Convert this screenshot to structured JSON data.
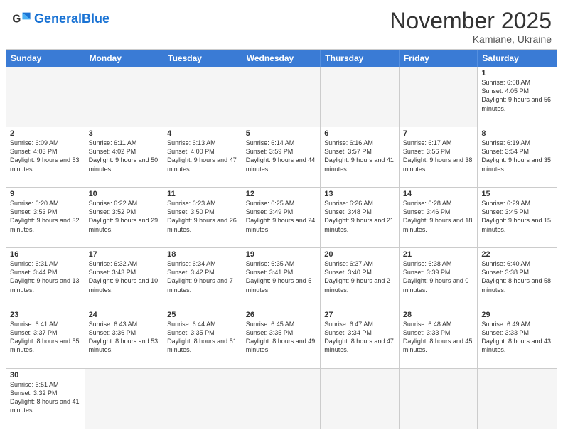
{
  "header": {
    "logo_general": "General",
    "logo_blue": "Blue",
    "month_title": "November 2025",
    "subtitle": "Kamiane, Ukraine"
  },
  "weekdays": [
    "Sunday",
    "Monday",
    "Tuesday",
    "Wednesday",
    "Thursday",
    "Friday",
    "Saturday"
  ],
  "rows": [
    [
      {
        "num": "",
        "info": "",
        "empty": true
      },
      {
        "num": "",
        "info": "",
        "empty": true
      },
      {
        "num": "",
        "info": "",
        "empty": true
      },
      {
        "num": "",
        "info": "",
        "empty": true
      },
      {
        "num": "",
        "info": "",
        "empty": true
      },
      {
        "num": "",
        "info": "",
        "empty": true
      },
      {
        "num": "1",
        "info": "Sunrise: 6:08 AM\nSunset: 4:05 PM\nDaylight: 9 hours and 56 minutes.",
        "empty": false
      }
    ],
    [
      {
        "num": "2",
        "info": "Sunrise: 6:09 AM\nSunset: 4:03 PM\nDaylight: 9 hours and 53 minutes.",
        "empty": false
      },
      {
        "num": "3",
        "info": "Sunrise: 6:11 AM\nSunset: 4:02 PM\nDaylight: 9 hours and 50 minutes.",
        "empty": false
      },
      {
        "num": "4",
        "info": "Sunrise: 6:13 AM\nSunset: 4:00 PM\nDaylight: 9 hours and 47 minutes.",
        "empty": false
      },
      {
        "num": "5",
        "info": "Sunrise: 6:14 AM\nSunset: 3:59 PM\nDaylight: 9 hours and 44 minutes.",
        "empty": false
      },
      {
        "num": "6",
        "info": "Sunrise: 6:16 AM\nSunset: 3:57 PM\nDaylight: 9 hours and 41 minutes.",
        "empty": false
      },
      {
        "num": "7",
        "info": "Sunrise: 6:17 AM\nSunset: 3:56 PM\nDaylight: 9 hours and 38 minutes.",
        "empty": false
      },
      {
        "num": "8",
        "info": "Sunrise: 6:19 AM\nSunset: 3:54 PM\nDaylight: 9 hours and 35 minutes.",
        "empty": false
      }
    ],
    [
      {
        "num": "9",
        "info": "Sunrise: 6:20 AM\nSunset: 3:53 PM\nDaylight: 9 hours and 32 minutes.",
        "empty": false
      },
      {
        "num": "10",
        "info": "Sunrise: 6:22 AM\nSunset: 3:52 PM\nDaylight: 9 hours and 29 minutes.",
        "empty": false
      },
      {
        "num": "11",
        "info": "Sunrise: 6:23 AM\nSunset: 3:50 PM\nDaylight: 9 hours and 26 minutes.",
        "empty": false
      },
      {
        "num": "12",
        "info": "Sunrise: 6:25 AM\nSunset: 3:49 PM\nDaylight: 9 hours and 24 minutes.",
        "empty": false
      },
      {
        "num": "13",
        "info": "Sunrise: 6:26 AM\nSunset: 3:48 PM\nDaylight: 9 hours and 21 minutes.",
        "empty": false
      },
      {
        "num": "14",
        "info": "Sunrise: 6:28 AM\nSunset: 3:46 PM\nDaylight: 9 hours and 18 minutes.",
        "empty": false
      },
      {
        "num": "15",
        "info": "Sunrise: 6:29 AM\nSunset: 3:45 PM\nDaylight: 9 hours and 15 minutes.",
        "empty": false
      }
    ],
    [
      {
        "num": "16",
        "info": "Sunrise: 6:31 AM\nSunset: 3:44 PM\nDaylight: 9 hours and 13 minutes.",
        "empty": false
      },
      {
        "num": "17",
        "info": "Sunrise: 6:32 AM\nSunset: 3:43 PM\nDaylight: 9 hours and 10 minutes.",
        "empty": false
      },
      {
        "num": "18",
        "info": "Sunrise: 6:34 AM\nSunset: 3:42 PM\nDaylight: 9 hours and 7 minutes.",
        "empty": false
      },
      {
        "num": "19",
        "info": "Sunrise: 6:35 AM\nSunset: 3:41 PM\nDaylight: 9 hours and 5 minutes.",
        "empty": false
      },
      {
        "num": "20",
        "info": "Sunrise: 6:37 AM\nSunset: 3:40 PM\nDaylight: 9 hours and 2 minutes.",
        "empty": false
      },
      {
        "num": "21",
        "info": "Sunrise: 6:38 AM\nSunset: 3:39 PM\nDaylight: 9 hours and 0 minutes.",
        "empty": false
      },
      {
        "num": "22",
        "info": "Sunrise: 6:40 AM\nSunset: 3:38 PM\nDaylight: 8 hours and 58 minutes.",
        "empty": false
      }
    ],
    [
      {
        "num": "23",
        "info": "Sunrise: 6:41 AM\nSunset: 3:37 PM\nDaylight: 8 hours and 55 minutes.",
        "empty": false
      },
      {
        "num": "24",
        "info": "Sunrise: 6:43 AM\nSunset: 3:36 PM\nDaylight: 8 hours and 53 minutes.",
        "empty": false
      },
      {
        "num": "25",
        "info": "Sunrise: 6:44 AM\nSunset: 3:35 PM\nDaylight: 8 hours and 51 minutes.",
        "empty": false
      },
      {
        "num": "26",
        "info": "Sunrise: 6:45 AM\nSunset: 3:35 PM\nDaylight: 8 hours and 49 minutes.",
        "empty": false
      },
      {
        "num": "27",
        "info": "Sunrise: 6:47 AM\nSunset: 3:34 PM\nDaylight: 8 hours and 47 minutes.",
        "empty": false
      },
      {
        "num": "28",
        "info": "Sunrise: 6:48 AM\nSunset: 3:33 PM\nDaylight: 8 hours and 45 minutes.",
        "empty": false
      },
      {
        "num": "29",
        "info": "Sunrise: 6:49 AM\nSunset: 3:33 PM\nDaylight: 8 hours and 43 minutes.",
        "empty": false
      }
    ],
    [
      {
        "num": "30",
        "info": "Sunrise: 6:51 AM\nSunset: 3:32 PM\nDaylight: 8 hours and 41 minutes.",
        "empty": false
      },
      {
        "num": "",
        "info": "",
        "empty": true
      },
      {
        "num": "",
        "info": "",
        "empty": true
      },
      {
        "num": "",
        "info": "",
        "empty": true
      },
      {
        "num": "",
        "info": "",
        "empty": true
      },
      {
        "num": "",
        "info": "",
        "empty": true
      },
      {
        "num": "",
        "info": "",
        "empty": true
      }
    ]
  ]
}
